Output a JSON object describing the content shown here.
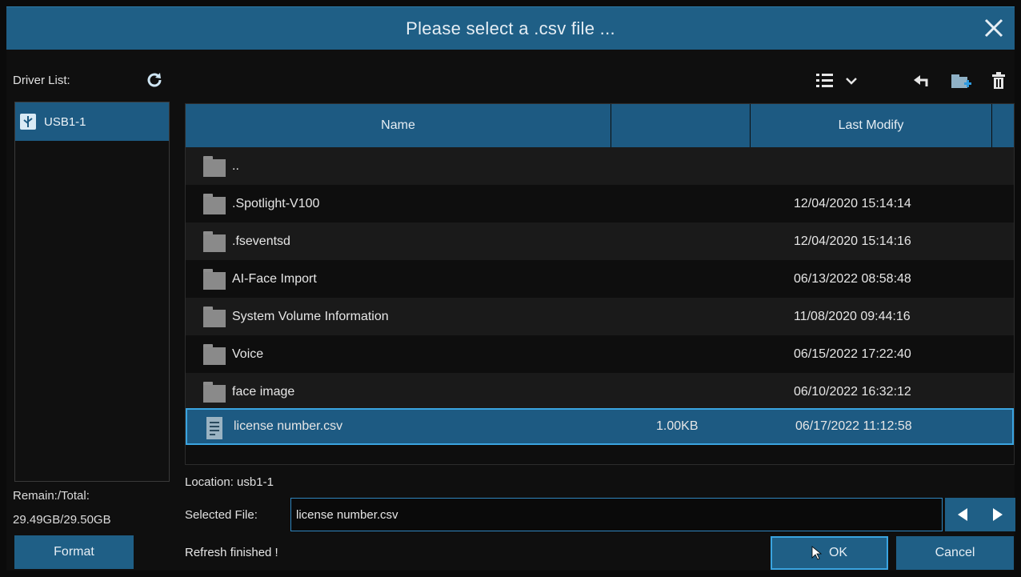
{
  "dialog": {
    "title": "Please select a .csv file ..."
  },
  "sidebar": {
    "driver_list_label": "Driver List:",
    "drivers": [
      {
        "label": "USB1-1",
        "selected": true
      }
    ],
    "remain_label": "Remain:/Total:",
    "remain_value": "29.49GB/29.50GB",
    "format_label": "Format"
  },
  "table": {
    "columns": [
      "Name",
      "",
      "Last Modify"
    ],
    "rows": [
      {
        "type": "folder",
        "name": "..",
        "size": "",
        "modified": ""
      },
      {
        "type": "folder",
        "name": ".Spotlight-V100",
        "size": "",
        "modified": "12/04/2020 15:14:14"
      },
      {
        "type": "folder",
        "name": ".fseventsd",
        "size": "",
        "modified": "12/04/2020 15:14:16"
      },
      {
        "type": "folder",
        "name": "AI-Face Import",
        "size": "",
        "modified": "06/13/2022 08:58:48"
      },
      {
        "type": "folder",
        "name": "System Volume Information",
        "size": "",
        "modified": "11/08/2020 09:44:16"
      },
      {
        "type": "folder",
        "name": "Voice",
        "size": "",
        "modified": "06/15/2022 17:22:40"
      },
      {
        "type": "folder",
        "name": "face image",
        "size": "",
        "modified": "06/10/2022 16:32:12"
      },
      {
        "type": "file",
        "name": "license number.csv",
        "size": "1.00KB",
        "modified": "06/17/2022 11:12:58",
        "selected": true
      }
    ]
  },
  "footer": {
    "location": "Location: usb1-1",
    "selected_file_label": "Selected File:",
    "selected_file_value": "license number.csv",
    "status": "Refresh finished !",
    "ok_label": "OK",
    "cancel_label": "Cancel"
  },
  "icons": {
    "close": "close-icon",
    "refresh": "refresh-icon",
    "view": "list-view-icon",
    "back": "back-arrow-icon",
    "new_folder": "new-folder-icon",
    "delete": "trash-icon",
    "prev": "left-triangle-icon",
    "next": "right-triangle-icon"
  },
  "colors": {
    "accent": "#1f5f86",
    "highlight_border": "#3aa4e0",
    "background": "#0f0f0f"
  }
}
